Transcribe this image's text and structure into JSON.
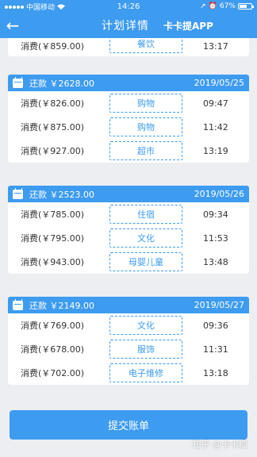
{
  "status_bar": {
    "carrier": "中国移动",
    "time": "14:26",
    "battery": "67%",
    "battery_level": 0.67
  },
  "header": {
    "title": "计划详情",
    "app_name": "卡卡提APP",
    "back_icon": "arrow-left-icon"
  },
  "top_row": {
    "amount": "消费(￥859.00)",
    "tag": "餐饮",
    "time": "13:17"
  },
  "groups": [
    {
      "repay": "还款 ￥2628.00",
      "date": "2019/05/25",
      "rows": [
        {
          "amount": "消费(￥826.00)",
          "tag": "购物",
          "time": "09:47"
        },
        {
          "amount": "消费(￥875.00)",
          "tag": "购物",
          "time": "11:42"
        },
        {
          "amount": "消费(￥927.00)",
          "tag": "超市",
          "time": "13:19"
        }
      ]
    },
    {
      "repay": "还款 ￥2523.00",
      "date": "2019/05/26",
      "rows": [
        {
          "amount": "消费(￥785.00)",
          "tag": "住宿",
          "time": "09:34"
        },
        {
          "amount": "消费(￥795.00)",
          "tag": "文化",
          "time": "11:53"
        },
        {
          "amount": "消费(￥943.00)",
          "tag": "母婴儿童",
          "time": "13:48"
        }
      ]
    },
    {
      "repay": "还款 ￥2149.00",
      "date": "2019/05/27",
      "rows": [
        {
          "amount": "消费(￥769.00)",
          "tag": "文化",
          "time": "09:36"
        },
        {
          "amount": "消费(￥678.00)",
          "tag": "服饰",
          "time": "11:31"
        },
        {
          "amount": "消费(￥702.00)",
          "tag": "电子维修",
          "time": "13:18"
        }
      ]
    }
  ],
  "submit_label": "提交账单",
  "watermark": "知乎 @卡卡提",
  "colors": {
    "accent": "#3d9bf0",
    "background": "#eceef2"
  }
}
